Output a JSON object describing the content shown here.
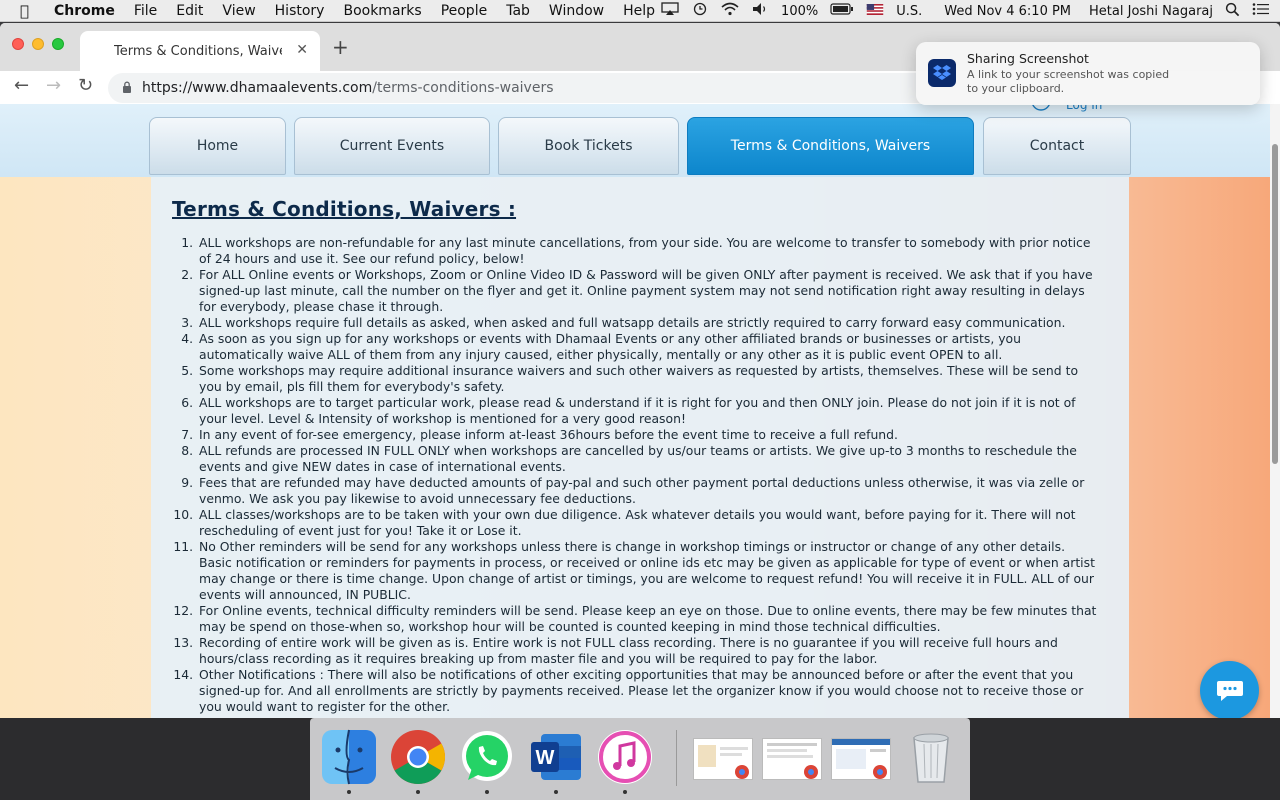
{
  "menubar": {
    "app_name": "Chrome",
    "items": [
      "File",
      "Edit",
      "View",
      "History",
      "Bookmarks",
      "People",
      "Tab",
      "Window",
      "Help"
    ],
    "battery": "100%",
    "input_source": "U.S.",
    "datetime": "Wed Nov 4  6:10 PM",
    "user": "Hetal Joshi Nagaraj"
  },
  "browser": {
    "tab_title": "Terms & Conditions, Waivers | D",
    "url_host": "https://www.dhamaalevents.com",
    "url_path": "/terms-conditions-waivers"
  },
  "site": {
    "login_label": "Log In",
    "nav": [
      {
        "label": "Home"
      },
      {
        "label": "Current Events"
      },
      {
        "label": "Book Tickets"
      },
      {
        "label": "Terms & Conditions, Waivers",
        "active": true
      },
      {
        "label": "Contact"
      }
    ],
    "page_title": "Terms & Conditions, Waivers :",
    "terms": [
      "ALL workshops are non-refundable for any last minute cancellations, from your side. You are welcome to transfer to somebody with prior notice of 24 hours and use it. See our refund policy, below!",
      "For ALL Online events or Workshops, Zoom or Online Video ID & Password will be given ONLY after payment is received. We ask that if you have signed-up last minute, call the number on the flyer and get it. Online payment system may not send notification right away resulting in delays for everybody, please chase it through.",
      "ALL workshops require full details as asked, when asked and full watsapp details are strictly required to carry forward easy communication.",
      "As soon as you sign up for any workshops or events with Dhamaal Events or any other affiliated brands or businesses or artists, you automatically waive ALL of them from any injury caused, either physically, mentally or any other as it is public event OPEN to all.",
      "Some workshops may require additional insurance waivers and such other waivers as requested by artists, themselves. These will be send to you by email, pls fill them for everybody's safety.",
      "ALL workshops are to target particular work, please read & understand if it is right for you and then ONLY join. Please do not join if it is not of your level. Level & Intensity of workshop is mentioned for a very good reason!",
      "In any event of for-see emergency, please inform at-least 36hours before the event time to receive a full refund.",
      "ALL refunds are processed IN FULL ONLY when workshops are cancelled by us/our teams or artists. We give up-to 3 months to reschedule the events and give NEW dates in case of international events.",
      "Fees that are refunded may have deducted amounts of pay-pal and such other payment portal deductions unless otherwise, it was via zelle or venmo. We ask you pay likewise to avoid unnecessary fee deductions.",
      "ALL classes/workshops are to be taken with your own due diligence. Ask whatever details you would want, before paying for it. There will not rescheduling of event just for you! Take it or Lose it.",
      "No Other reminders will be send for any workshops unless there is change in workshop timings or instructor or change of any other details. Basic notification or reminders for payments in process, or received or online ids etc may be given as applicable for type of event or when artist may change or there is time change. Upon change of artist or timings, you are welcome to request refund! You will receive it in FULL. ALL of our events will announced, IN PUBLIC.",
      "For Online events, technical difficulty reminders will be send. Please keep an eye on those. Due to online events, there may be few minutes that may be spend on those-when so, workshop hour will be counted is counted keeping in mind those technical difficulties.",
      "Recording of entire work will be given as is. Entire work is not FULL class recording. There is no guarantee if you will receive full hours and hours/class recording as it requires breaking up from master file and you will be required to pay for the labor.",
      "Other Notifications : There will also be notifications of other exciting opportunities that may be announced before or after the event that you signed-up for. And all enrollments are strictly by payments received. Please let the organizer know if you would choose not to receive those or you would want to register for the other."
    ]
  },
  "notification": {
    "title": "Sharing Screenshot",
    "body": "A link to your screenshot was copied to your clipboard."
  },
  "dock": {
    "apps": [
      "finder-icon",
      "chrome-icon",
      "whatsapp-icon",
      "word-icon",
      "itunes-icon"
    ]
  },
  "colors": {
    "nav_active": "#0d86cc",
    "title": "#0d2a4a",
    "chat": "#1c98e0"
  }
}
